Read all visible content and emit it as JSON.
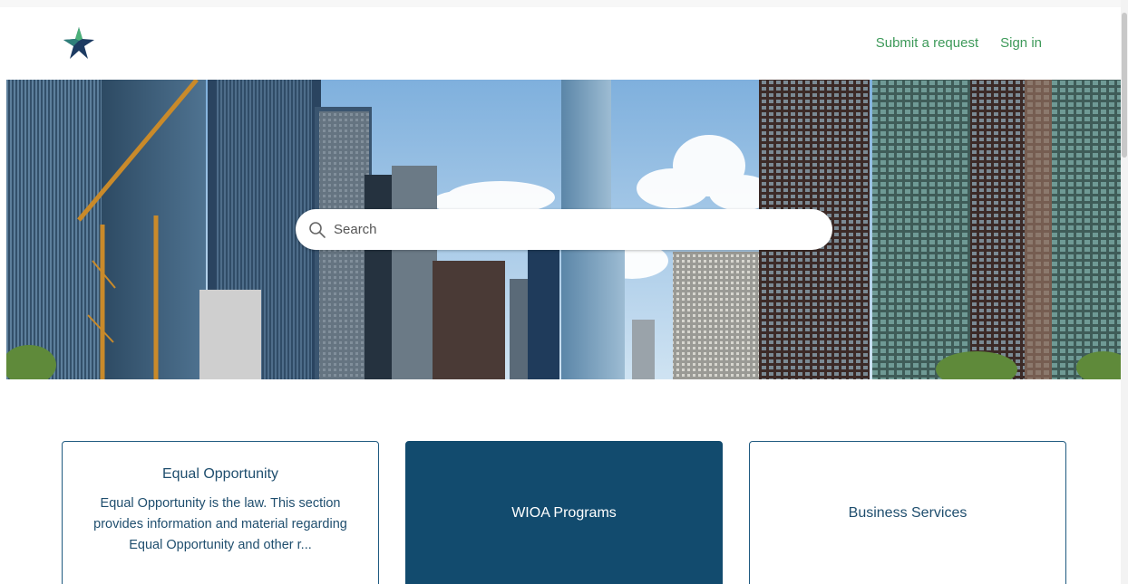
{
  "header": {
    "logo": "star-logo",
    "nav": {
      "submit_request": "Submit a request",
      "sign_in": "Sign in"
    }
  },
  "hero": {
    "search": {
      "placeholder": "Search",
      "value": ""
    }
  },
  "categories": [
    {
      "title": "Equal Opportunity",
      "description": "Equal Opportunity is the law. This section provides information and material regarding Equal Opportunity and other r..."
    },
    {
      "title": "WIOA Programs",
      "description": ""
    },
    {
      "title": "Business Services",
      "description": ""
    }
  ],
  "colors": {
    "nav_link": "#3e9a5a",
    "card_border": "#1f5a80",
    "card_active_bg": "#124b6e",
    "card_text": "#1f4e6e"
  }
}
